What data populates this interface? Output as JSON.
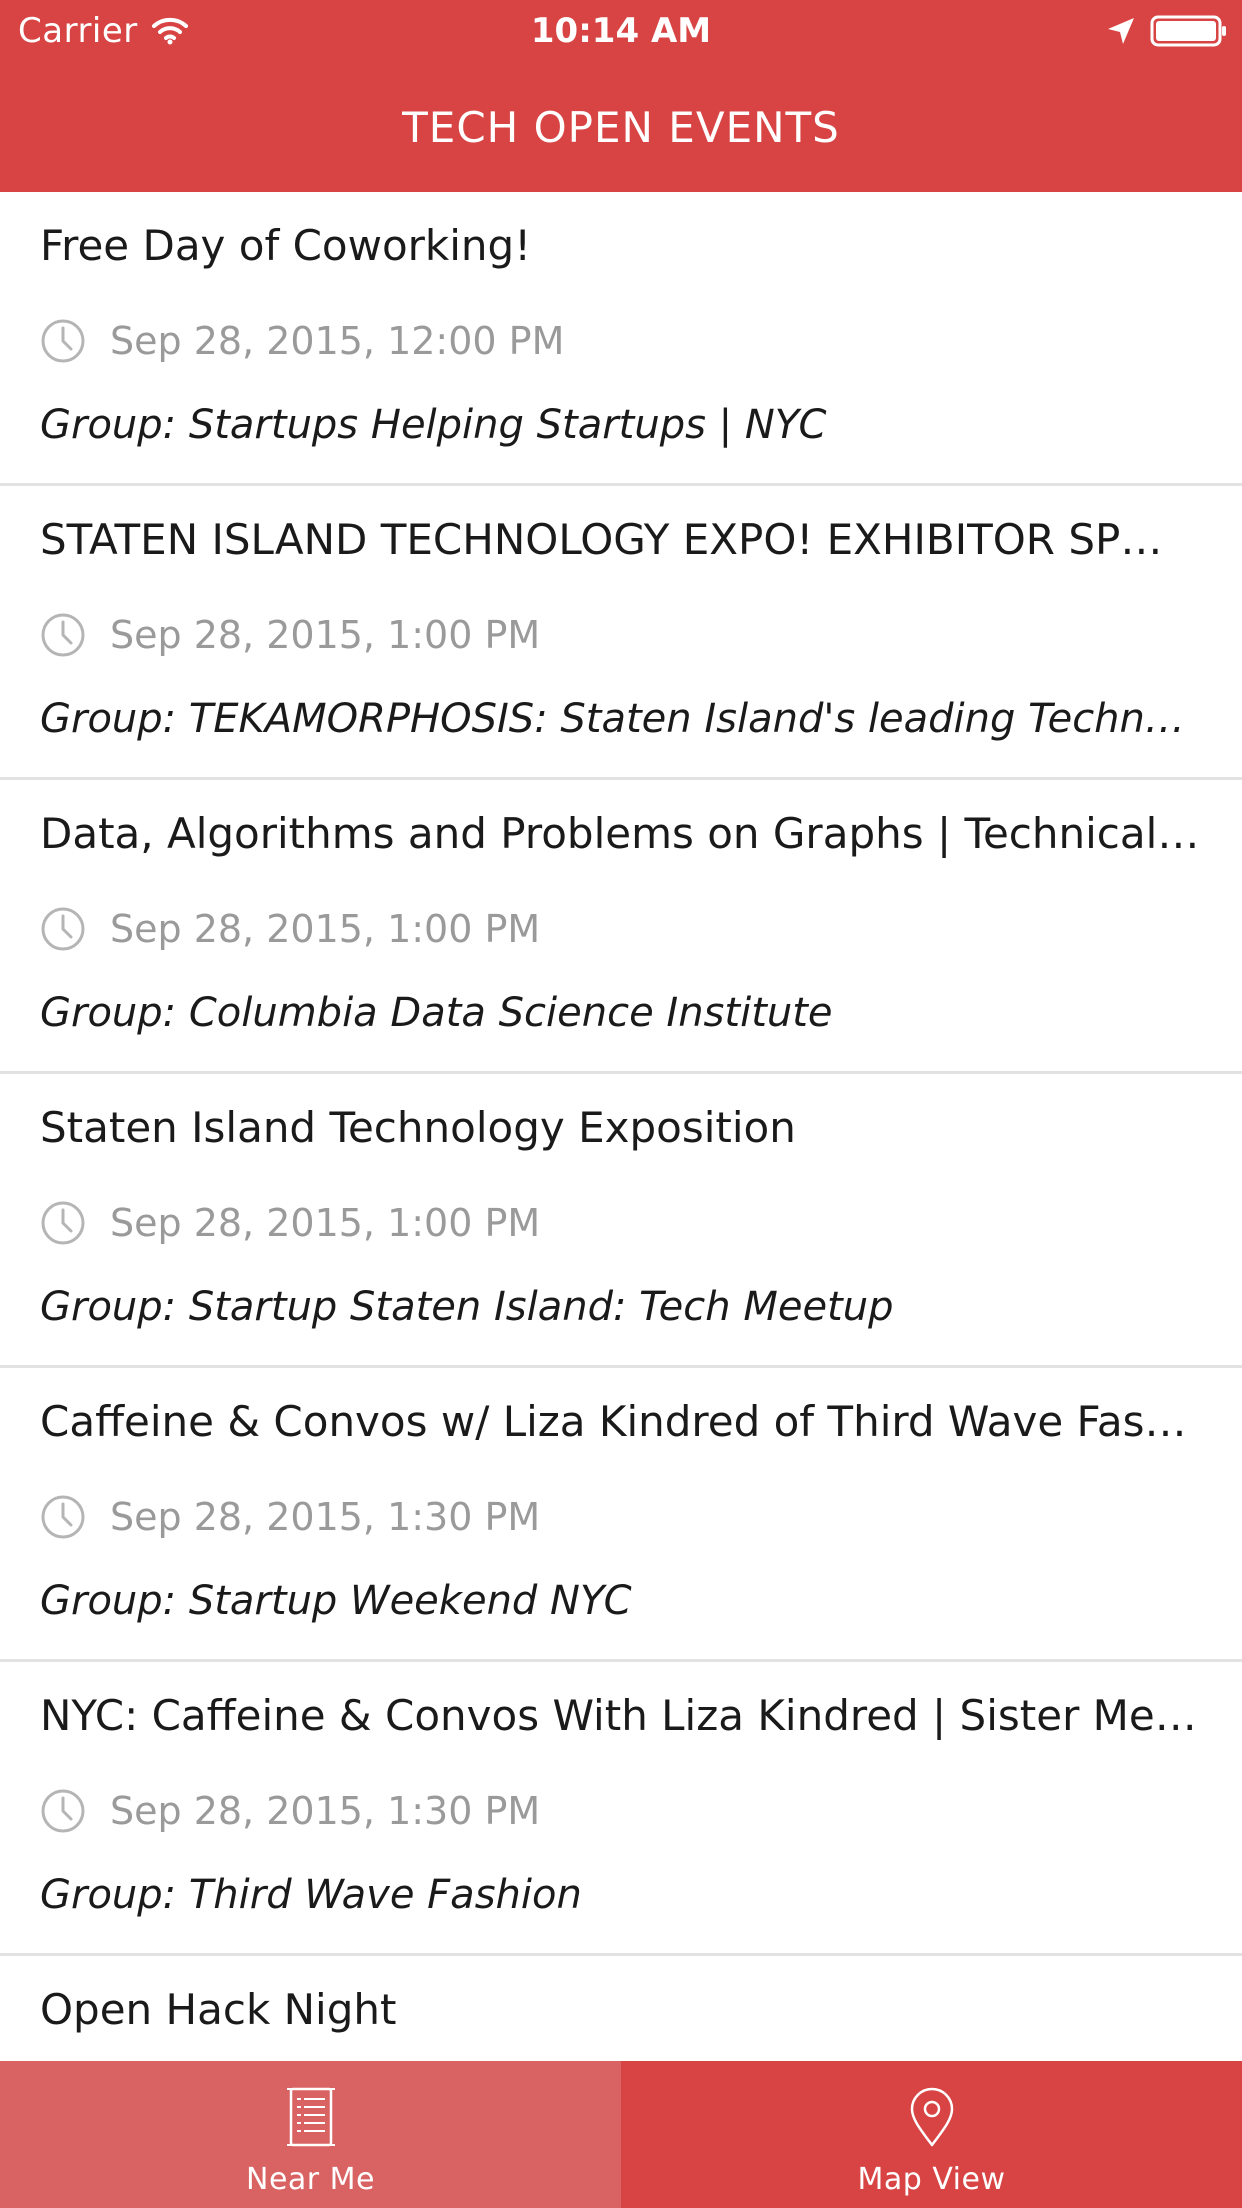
{
  "colors": {
    "brand_red": "#d84444",
    "tab_active_bg": "#d96262",
    "time_gray": "#9a9a9a",
    "divider": "#e2e2e2"
  },
  "status_bar": {
    "carrier": "Carrier",
    "time": "10:14 AM",
    "icons": [
      "wifi-icon",
      "location-arrow-icon",
      "battery-icon"
    ]
  },
  "nav": {
    "title": "TECH OPEN EVENTS"
  },
  "events": [
    {
      "title": "Free Day of Coworking!",
      "time": "Sep 28, 2015, 12:00 PM",
      "group": "Group: Startups Helping Startups | NYC"
    },
    {
      "title": "STATEN ISLAND TECHNOLOGY EXPO! EXHIBITOR SP…",
      "time": "Sep 28, 2015, 1:00 PM",
      "group": "Group: TEKAMORPHOSIS: Staten Island's leading Technolo…"
    },
    {
      "title": "Data, Algorithms and Problems on Graphs | Technical T…",
      "time": "Sep 28, 2015, 1:00 PM",
      "group": "Group: Columbia Data Science Institute"
    },
    {
      "title": "Staten Island Technology Exposition",
      "time": "Sep 28, 2015, 1:00 PM",
      "group": "Group: Startup Staten Island: Tech Meetup"
    },
    {
      "title": "Caffeine & Convos w/ Liza Kindred of Third Wave Fashion",
      "time": "Sep 28, 2015, 1:30 PM",
      "group": "Group: Startup Weekend NYC"
    },
    {
      "title": "NYC: Caffeine & Convos With Liza Kindred | Sister Mee…",
      "time": "Sep 28, 2015, 1:30 PM",
      "group": "Group: Third Wave Fashion"
    },
    {
      "title": "Open Hack Night",
      "time": "",
      "group": ""
    }
  ],
  "tab_bar": {
    "tabs": [
      {
        "label": "Near Me",
        "icon": "list-document-icon",
        "selected": true
      },
      {
        "label": "Map View",
        "icon": "map-pin-icon",
        "selected": false
      }
    ]
  }
}
